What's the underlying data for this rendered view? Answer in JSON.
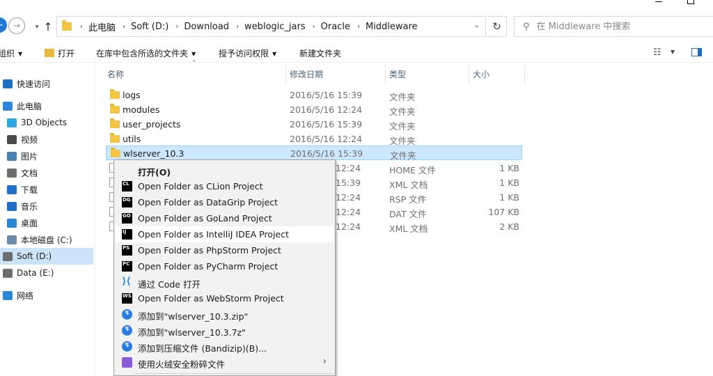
{
  "address_bar": {
    "breadcrumbs": [
      "此电脑",
      "Soft (D:)",
      "Download",
      "weblogic_jars",
      "Oracle",
      "Middleware"
    ]
  },
  "search": {
    "placeholder": "在 Middleware 中搜索"
  },
  "command_bar": {
    "organize": "组织",
    "open": "打开",
    "include_in_library": "在库中包含所选的文件夹",
    "share_with": "授予访问权限",
    "new_folder": "新建文件夹"
  },
  "nav_pane": {
    "items": [
      {
        "label": "快速访问",
        "icon": "star-icon",
        "color": "#1f6fc5"
      },
      {
        "label": "此电脑",
        "icon": "computer-icon",
        "color": "#2a88d8"
      },
      {
        "label": "3D Objects",
        "icon": "cube-icon",
        "color": "#2da8e0"
      },
      {
        "label": "视频",
        "icon": "video-icon",
        "color": "#4a4a4a"
      },
      {
        "label": "图片",
        "icon": "picture-icon",
        "color": "#4a7fb0"
      },
      {
        "label": "文档",
        "icon": "document-icon",
        "color": "#6d6d6d"
      },
      {
        "label": "下载",
        "icon": "download-icon",
        "color": "#1f6fc5"
      },
      {
        "label": "音乐",
        "icon": "music-icon",
        "color": "#1f6fc5"
      },
      {
        "label": "桌面",
        "icon": "desktop-icon",
        "color": "#2a88d8"
      },
      {
        "label": "本地磁盘 (C:)",
        "icon": "drive-icon",
        "color": "#6d8aa8"
      },
      {
        "label": "Soft (D:)",
        "icon": "drive-icon",
        "color": "#6d6d6d"
      },
      {
        "label": "Data (E:)",
        "icon": "drive-icon",
        "color": "#6d6d6d"
      },
      {
        "label": "网络",
        "icon": "network-icon",
        "color": "#2a88d8"
      }
    ],
    "selected_index": 10
  },
  "file_list": {
    "columns": {
      "name": "名称",
      "date": "修改日期",
      "type": "类型",
      "size": "大小"
    },
    "rows": [
      {
        "name": "logs",
        "date": "2016/5/16 15:39",
        "type": "文件夹",
        "size": "",
        "kind": "folder"
      },
      {
        "name": "modules",
        "date": "2016/5/16 12:24",
        "type": "文件夹",
        "size": "",
        "kind": "folder"
      },
      {
        "name": "user_projects",
        "date": "2016/5/16 15:39",
        "type": "文件夹",
        "size": "",
        "kind": "folder"
      },
      {
        "name": "utils",
        "date": "2016/5/16 12:24",
        "type": "文件夹",
        "size": "",
        "kind": "folder"
      },
      {
        "name": "wlserver_10.3",
        "date": "2016/5/16 15:39",
        "type": "文件夹",
        "size": "",
        "kind": "folder"
      },
      {
        "name": "",
        "date": "12:24",
        "type": "HOME 文件",
        "size": "1 KB",
        "kind": "file"
      },
      {
        "name": "",
        "date": "15:39",
        "type": "XML 文档",
        "size": "1 KB",
        "kind": "file"
      },
      {
        "name": "",
        "date": "12:24",
        "type": "RSP 文件",
        "size": "1 KB",
        "kind": "file"
      },
      {
        "name": "",
        "date": "12:24",
        "type": "DAT 文件",
        "size": "107 KB",
        "kind": "file"
      },
      {
        "name": "",
        "date": "12:24",
        "type": "XML 文档",
        "size": "2 KB",
        "kind": "file"
      }
    ],
    "selected_index": 4
  },
  "context_menu": {
    "items": [
      {
        "label": "打开(O)",
        "icon": "",
        "bold": true
      },
      {
        "label": "Open Folder as CLion Project",
        "icon": "clion-icon",
        "badge": "CL"
      },
      {
        "label": "Open Folder as DataGrip Project",
        "icon": "datagrip-icon",
        "badge": "DG"
      },
      {
        "label": "Open Folder as GoLand Project",
        "icon": "goland-icon",
        "badge": "GO"
      },
      {
        "label": "Open Folder as IntelliJ IDEA Project",
        "icon": "intellij-icon",
        "badge": "IJ",
        "hover": true
      },
      {
        "label": "Open Folder as PhpStorm Project",
        "icon": "phpstorm-icon",
        "badge": "PS"
      },
      {
        "label": "Open Folder as PyCharm Project",
        "icon": "pycharm-icon",
        "badge": "PC"
      },
      {
        "label": "通过 Code 打开",
        "icon": "vscode-icon",
        "badge": ""
      },
      {
        "label": "Open Folder as WebStorm Project",
        "icon": "webstorm-icon",
        "badge": "WS"
      },
      {
        "label": "添加到\"wlserver_10.3.zip\"",
        "icon": "bandizip-icon",
        "badge": ""
      },
      {
        "label": "添加到\"wlserver_10.3.7z\"",
        "icon": "bandizip-icon",
        "badge": ""
      },
      {
        "label": "添加到压缩文件 (Bandizip)(B)...",
        "icon": "bandizip-icon",
        "badge": ""
      },
      {
        "label": "使用火绒安全粉碎文件",
        "icon": "shredder-icon",
        "badge": "",
        "submenu": true
      }
    ]
  }
}
